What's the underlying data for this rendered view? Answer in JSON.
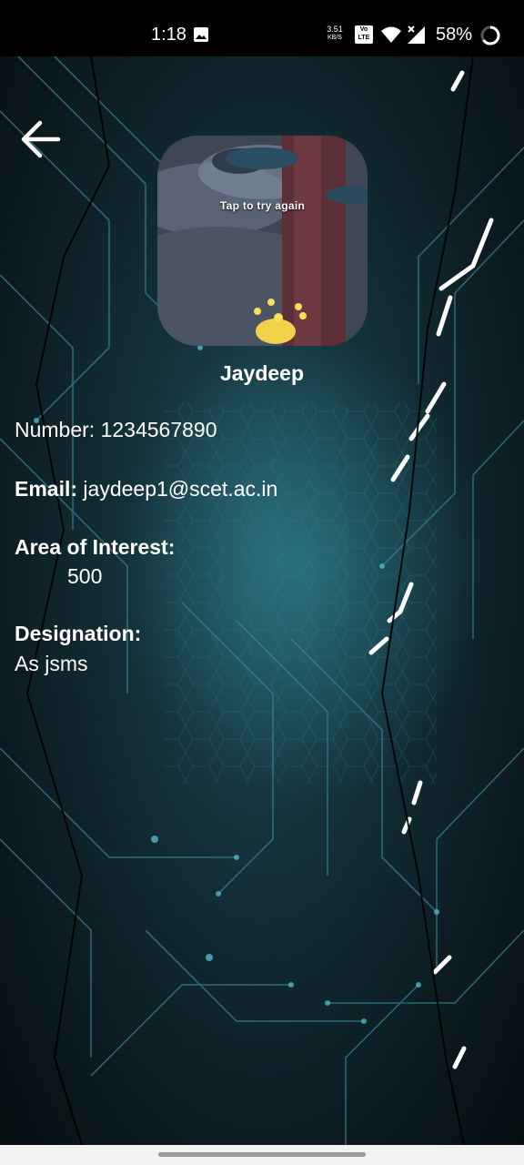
{
  "status_bar": {
    "time": "1:18",
    "net_speed_value": "3.51",
    "net_speed_unit": "KB/S",
    "volte_top": "Vo",
    "volte_bottom": "LTE",
    "battery_percent": "58%"
  },
  "header": {
    "back_icon": "arrow-left-icon"
  },
  "profile": {
    "avatar_caption": "Tap to try again",
    "name": "Jaydeep"
  },
  "fields": {
    "number_label": "Number:",
    "number_value": "1234567890",
    "email_label": "Email:",
    "email_value": "jaydeep1@scet.ac.in",
    "interest_label": "Area of Interest:",
    "interest_value": "500",
    "designation_label": "Designation:",
    "designation_value": "As jsms"
  },
  "colors": {
    "background": "#0b1519",
    "text": "#ffffff",
    "accent_teal": "#2a8fa0"
  }
}
